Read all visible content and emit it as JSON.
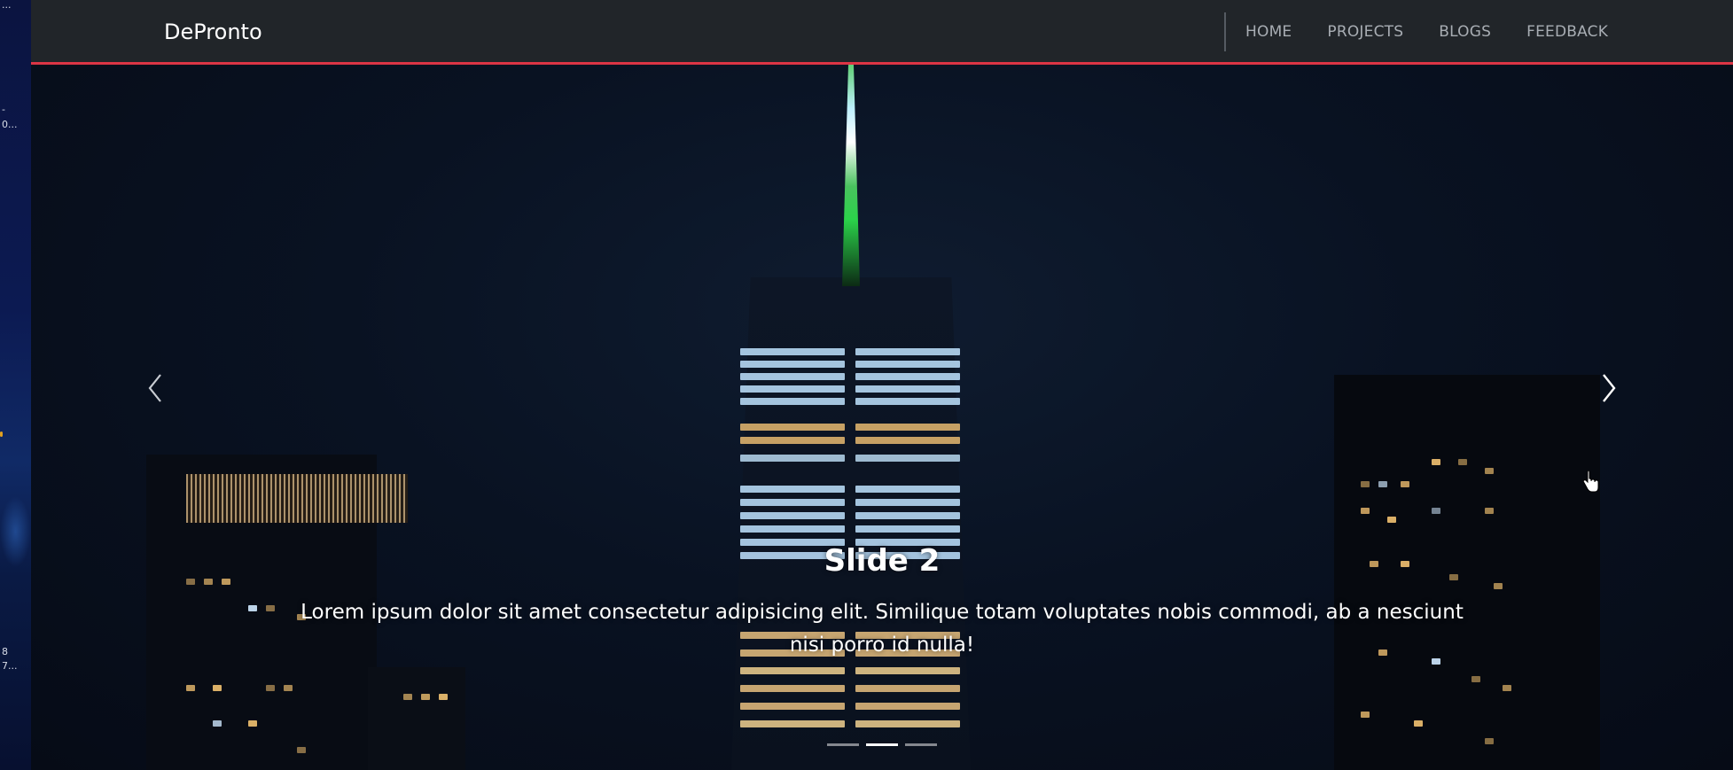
{
  "left_strip": {
    "fragments": [
      "...",
      "-",
      "0...",
      "8",
      "7..."
    ]
  },
  "navbar": {
    "brand": "DePronto",
    "links": [
      "HOME",
      "PROJECTS",
      "BLOGS",
      "FEEDBACK"
    ],
    "accent_color": "#dc3545",
    "background_color": "#212529"
  },
  "carousel": {
    "slide_title": "Slide 2",
    "slide_text": "Lorem ipsum dolor sit amet consectetur adipisicing elit. Similique totam voluptates nobis commodi, ab a nesciunt nisi porro id nulla!",
    "prev_icon": "chevron-left-icon",
    "next_icon": "chevron-right-icon",
    "indicator_count": 3,
    "active_indicator": 2
  }
}
